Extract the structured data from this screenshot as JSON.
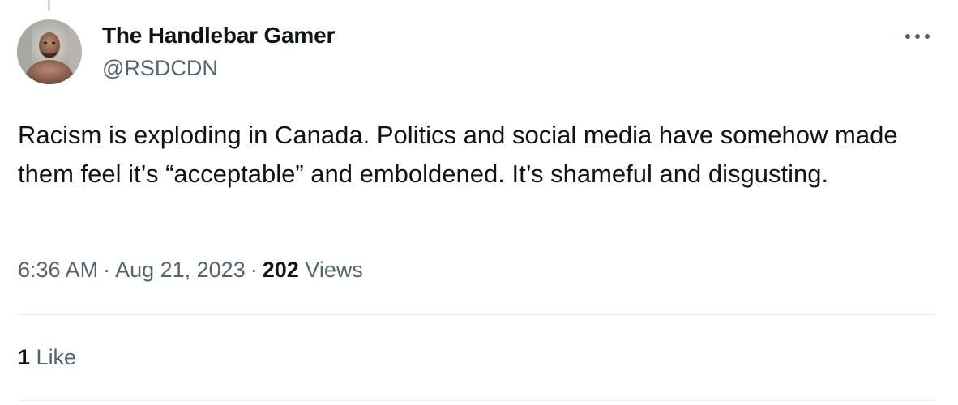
{
  "author": {
    "display_name": "The Handlebar Gamer",
    "handle": "@RSDCDN"
  },
  "icons": {
    "more": "more-horizontal-icon",
    "avatar": "avatar-photo"
  },
  "tweet": {
    "text": "Racism is exploding in Canada. Politics and social media have somehow made them feel it’s “acceptable” and emboldened. It’s shameful and disgusting."
  },
  "meta": {
    "time": "6:36 AM",
    "separator": "·",
    "date": "Aug 21, 2023",
    "views_count": "202",
    "views_label": "Views"
  },
  "engagement": {
    "likes_count": "1",
    "likes_label": "Like"
  },
  "colors": {
    "text_primary": "#0f1419",
    "text_secondary": "#536471",
    "divider": "#e6ecf0"
  }
}
